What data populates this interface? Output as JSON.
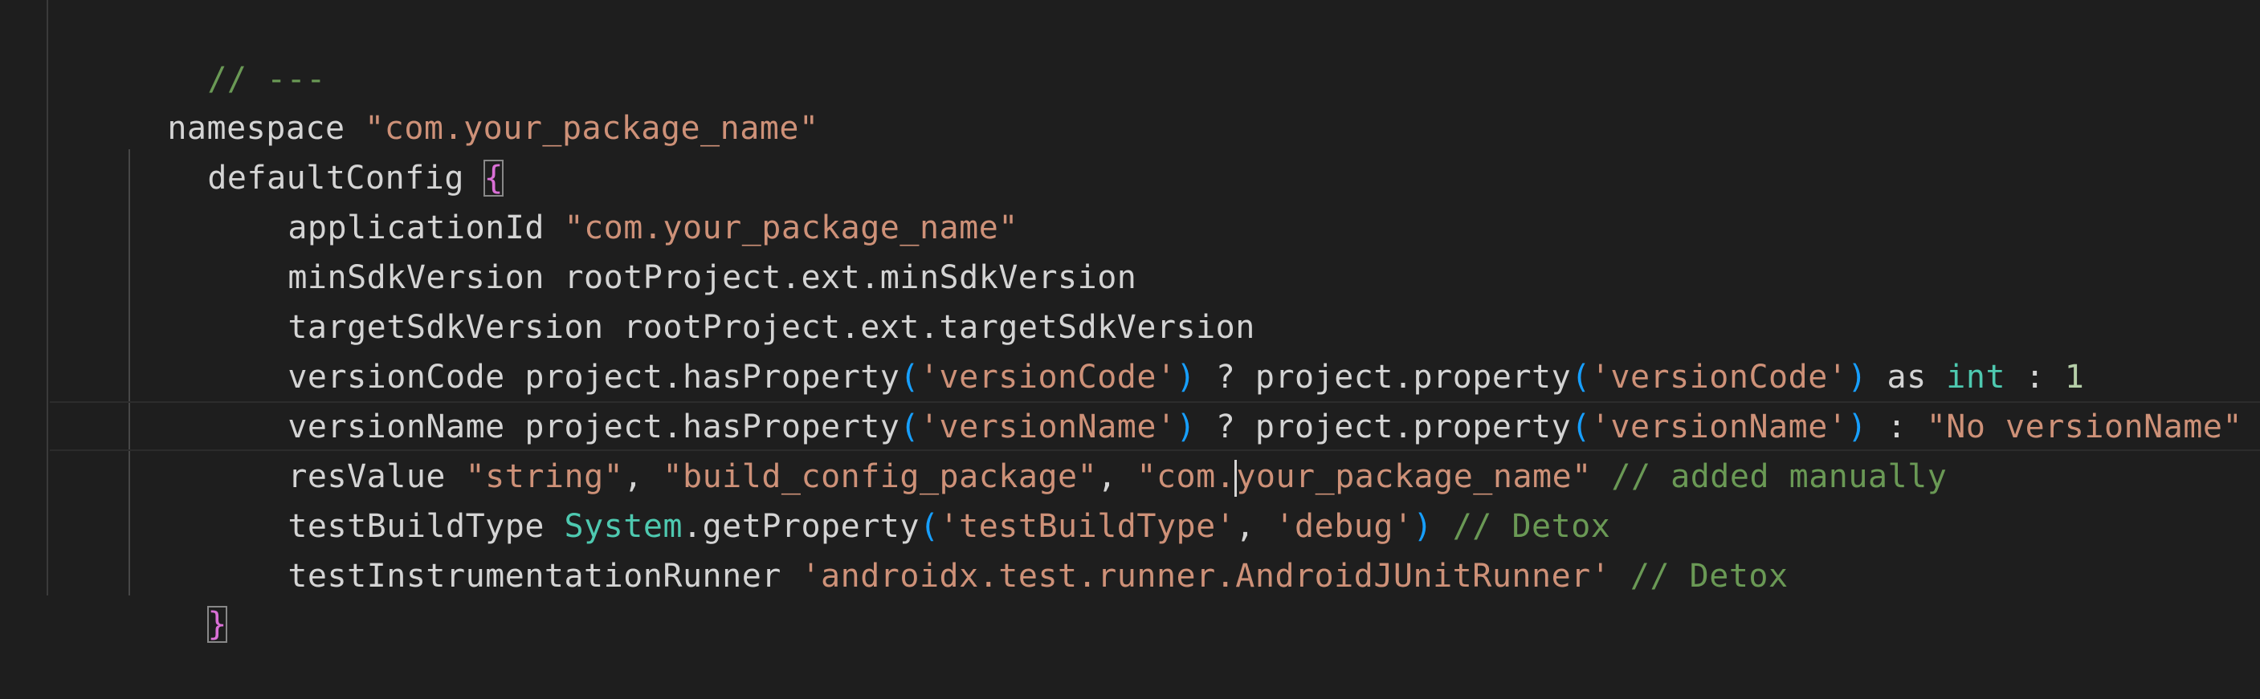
{
  "editor": {
    "lines": [
      {
        "comment": "// ---"
      },
      {
        "keyword": "namespace ",
        "value": "\"com.your_package_name\""
      },
      {
        "name": "defaultConfig ",
        "open": "{"
      },
      {
        "name": "applicationId ",
        "value": "\"com.your_package_name\""
      },
      {
        "text": "minSdkVersion rootProject.ext.minSdkVersion"
      },
      {
        "text": "targetSdkVersion rootProject.ext.targetSdkVersion"
      },
      {
        "a": "versionCode project.hasProperty",
        "p1": "(",
        "s1": "'versionCode'",
        "p2": ")",
        "b": " ? project.property",
        "p3": "(",
        "s2": "'versionCode'",
        "p4": ")",
        "c": " as ",
        "type": "int",
        "d": " : ",
        "num": "1"
      },
      {
        "a": "versionName project.hasProperty",
        "p1": "(",
        "s1": "'versionName'",
        "p2": ")",
        "b": " ? project.property",
        "p3": "(",
        "s2": "'versionName'",
        "p4": ")",
        "c": " : ",
        "s3": "\"No versionName\""
      },
      {
        "a": "resValue ",
        "s1": "\"string\"",
        "b": ", ",
        "s2": "\"build_config_package\"",
        "c": ", ",
        "s3a": "\"com.",
        "s3b": "your_package_name\"",
        "comment": " // added manually"
      },
      {
        "a": "testBuildType ",
        "type": "System",
        "b": ".getProperty",
        "p1": "(",
        "s1": "'testBuildType'",
        "c": ", ",
        "s2": "'debug'",
        "p2": ")",
        "comment": " // Detox"
      },
      {
        "a": "testInstrumentationRunner ",
        "s1": "'androidx.test.runner.AndroidJUnitRunner'",
        "comment": " // Detox"
      },
      {
        "close": "}"
      }
    ]
  },
  "colors": {
    "background": "#1e1e1e",
    "comment": "#6a9955",
    "string": "#ce9178",
    "text": "#d4d4d4",
    "type": "#4ec9b0",
    "number": "#b5cea8",
    "paren": "#179fff",
    "brace": "#da70d6"
  }
}
